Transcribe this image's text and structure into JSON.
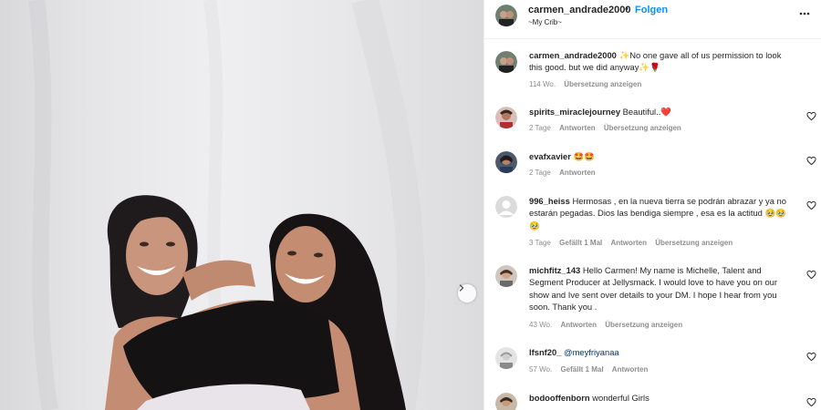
{
  "post": {
    "author": "carmen_andrade2000",
    "follow_label": "Folgen",
    "location": "~My Crib~",
    "separator": "•"
  },
  "caption": {
    "username": "carmen_andrade2000",
    "text": "✨No one gave all of us permission to look this good. but we did anyway✨🌹",
    "age": "114 Wo.",
    "translate": "Übersetzung anzeigen"
  },
  "comments": [
    {
      "username": "spirits_miraclejourney",
      "text": "Beautiful..❤️",
      "age": "2 Tage",
      "likes": "",
      "reply": "Antworten",
      "translate": "Übersetzung anzeigen"
    },
    {
      "username": "evafxavier",
      "text": "🤩🤩",
      "age": "2 Tage",
      "likes": "",
      "reply": "Antworten",
      "translate": ""
    },
    {
      "username": "996_heiss",
      "text": "Hermosas , en la nueva tierra se podrán abrazar y ya no estarán pegadas. Dios las bendiga siempre , esa es la actitud 🥹🥹🥹",
      "age": "3 Tage",
      "likes": "Gefällt 1 Mal",
      "reply": "Antworten",
      "translate": "Übersetzung anzeigen"
    },
    {
      "username": "michfitz_143",
      "text": "Hello Carmen! My name is Michelle, Talent and Segment Producer at Jellysmack. I would love to have you on our show and Ive sent over details to your DM. I hope I hear from you soon. Thank you .",
      "age": "43 Wo.",
      "likes": "",
      "reply": "Antworten",
      "translate": "Übersetzung anzeigen"
    },
    {
      "username": "lfsnf20_",
      "text": "@meyfriyanaa",
      "age": "57 Wo.",
      "likes": "Gefällt 1 Mal",
      "reply": "Antworten",
      "translate": ""
    },
    {
      "username": "bodooffenborn",
      "text": "wonderful Girls",
      "age": "",
      "likes": "",
      "reply": "",
      "translate": ""
    }
  ],
  "icons": {
    "more": "more-options-icon",
    "heart": "heart-outline-icon",
    "next": "chevron-right-icon"
  },
  "colors": {
    "link": "#0095f6",
    "muted": "#8e8e8e",
    "text": "#262626",
    "mention": "#00376b"
  }
}
